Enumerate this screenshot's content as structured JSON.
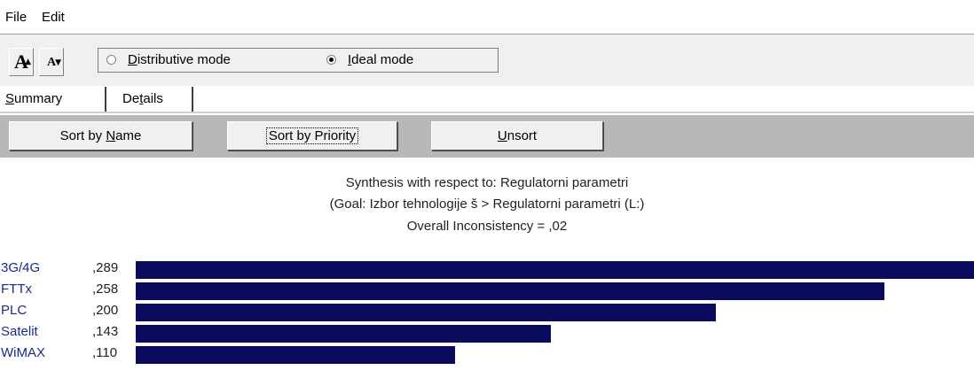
{
  "menu": {
    "file": "File",
    "edit": "Edit"
  },
  "toolbar": {
    "font_increase": "A",
    "font_decrease": "A",
    "modes": {
      "distributive": {
        "pre": "",
        "key": "D",
        "post": "istributive mode",
        "selected": false
      },
      "ideal": {
        "pre": "",
        "key": "I",
        "post": "deal mode",
        "selected": true
      }
    }
  },
  "tabs": {
    "summary": {
      "key": "S",
      "post": "ummary",
      "active": true
    },
    "details": {
      "pre": "De",
      "key": "t",
      "post": "ails",
      "active": false
    }
  },
  "sort_buttons": {
    "by_name": {
      "pre": "Sort by ",
      "key": "N",
      "post": "ame"
    },
    "by_priority": {
      "pre": "Sort by Priority",
      "key": "",
      "post": ""
    },
    "unsort": {
      "pre": "",
      "key": "U",
      "post": "nsort"
    }
  },
  "synthesis": {
    "line1": "Synthesis with respect to: Regulatorni parametri",
    "line2": "(Goal: Izbor tehnologije š > Regulatorni parametri (L:)",
    "line3": "Overall Inconsistency = ,02"
  },
  "chart_data": {
    "type": "bar",
    "orientation": "horizontal",
    "categories": [
      "3G/4G",
      "FTTx",
      "PLC",
      "Satelit",
      "WiMAX"
    ],
    "value_labels": [
      ",289",
      ",258",
      ",200",
      ",143",
      ",110"
    ],
    "values": [
      0.289,
      0.258,
      0.2,
      0.143,
      0.11
    ],
    "bar_color": "#0b0b5e",
    "label_color": "#1a2a8a"
  }
}
